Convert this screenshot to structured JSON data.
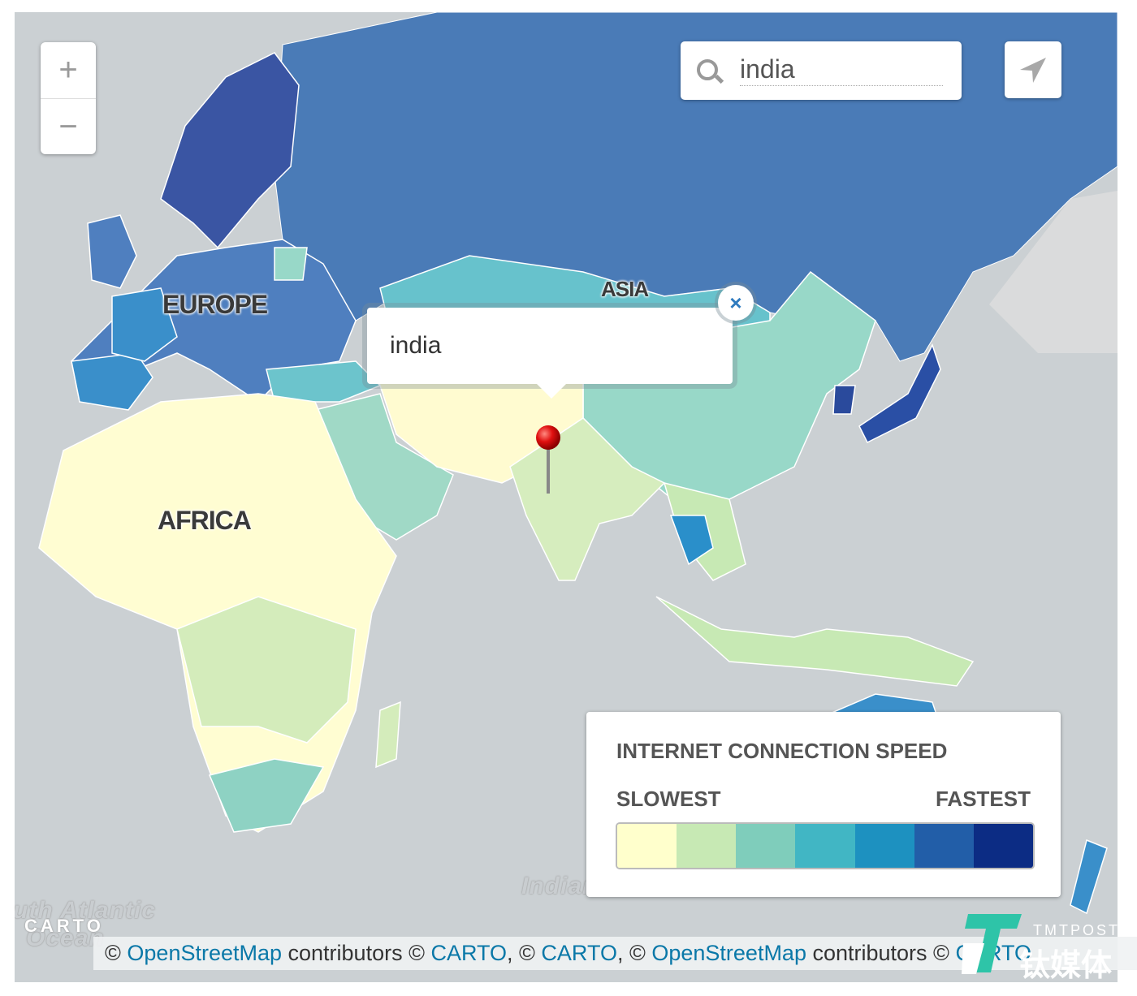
{
  "map": {
    "region_labels": {
      "europe": "EUROPE",
      "africa": "AFRICA",
      "asia": "ASIA"
    },
    "ocean_labels": {
      "indian": "Indian",
      "south_atlantic_1": "uth Atlantic",
      "south_atlantic_2": "Ocean"
    },
    "ocean_color": "#cbd0d3",
    "no_data_land_color": "#dadbdc"
  },
  "controls": {
    "zoom_in": "+",
    "zoom_out": "−",
    "search_icon": "magnifier-icon",
    "locate_icon": "navigation-arrow-icon"
  },
  "search": {
    "value": "india"
  },
  "popup": {
    "text": "india",
    "close": "×"
  },
  "marker": {
    "icon": "red-pushpin-icon",
    "location": "india"
  },
  "legend": {
    "title": "INTERNET CONNECTION SPEED",
    "low_label": "SLOWEST",
    "high_label": "FASTEST",
    "colors": [
      "#ffffcc",
      "#c7e9b4",
      "#7fcdbb",
      "#41b6c4",
      "#1d91c0",
      "#225ea8",
      "#0c2c84"
    ]
  },
  "attribution": {
    "logo": "CARTO",
    "prefix1": "© ",
    "link1": "OpenStreetMap",
    "text1": " contributors © ",
    "link2": "CARTO",
    "text2": ", © ",
    "link3": "CARTO",
    "text3": ", © ",
    "link4": "OpenStreetMap",
    "text4": " contributors © ",
    "link5": "CARTO"
  },
  "watermark": {
    "en": "TMTPOST",
    "cn": "钛媒体"
  }
}
